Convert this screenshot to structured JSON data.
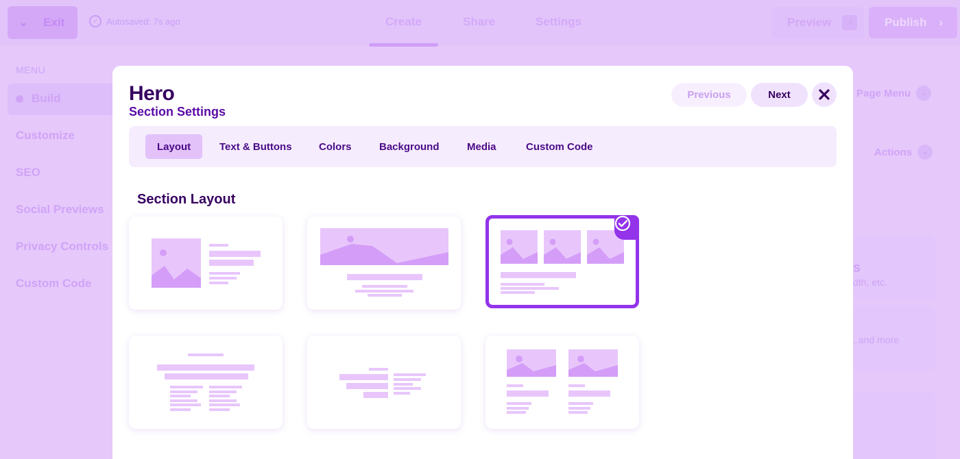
{
  "topbar": {
    "exit_label": "Exit",
    "autosave": "Autosaved: 7s ago",
    "tabs": [
      "Create",
      "Share",
      "Settings"
    ],
    "preview_label": "Preview",
    "publish_label": "Publish"
  },
  "sidebar": {
    "menu_label": "MENU",
    "items": [
      "Build",
      "Customize",
      "SEO",
      "Social Previews",
      "Privacy Controls",
      "Custom Code"
    ]
  },
  "right_panel": {
    "page_menu": "Page Menu",
    "actions": "Actions",
    "frag1": "s",
    "frag2": "dth, etc.",
    "frag3": ", and more"
  },
  "modal": {
    "title": "Hero",
    "subtitle": "Section Settings",
    "prev_label": "Previous",
    "next_label": "Next",
    "tabs": [
      "Layout",
      "Text & Buttons",
      "Colors",
      "Background",
      "Media",
      "Custom Code"
    ],
    "active_tab": "Layout",
    "section_title": "Section Layout",
    "selected_layout_index": 2
  },
  "colors": {
    "accent": "#9333ea",
    "placeholder": "#e8c6fb",
    "title": "#36005f"
  }
}
